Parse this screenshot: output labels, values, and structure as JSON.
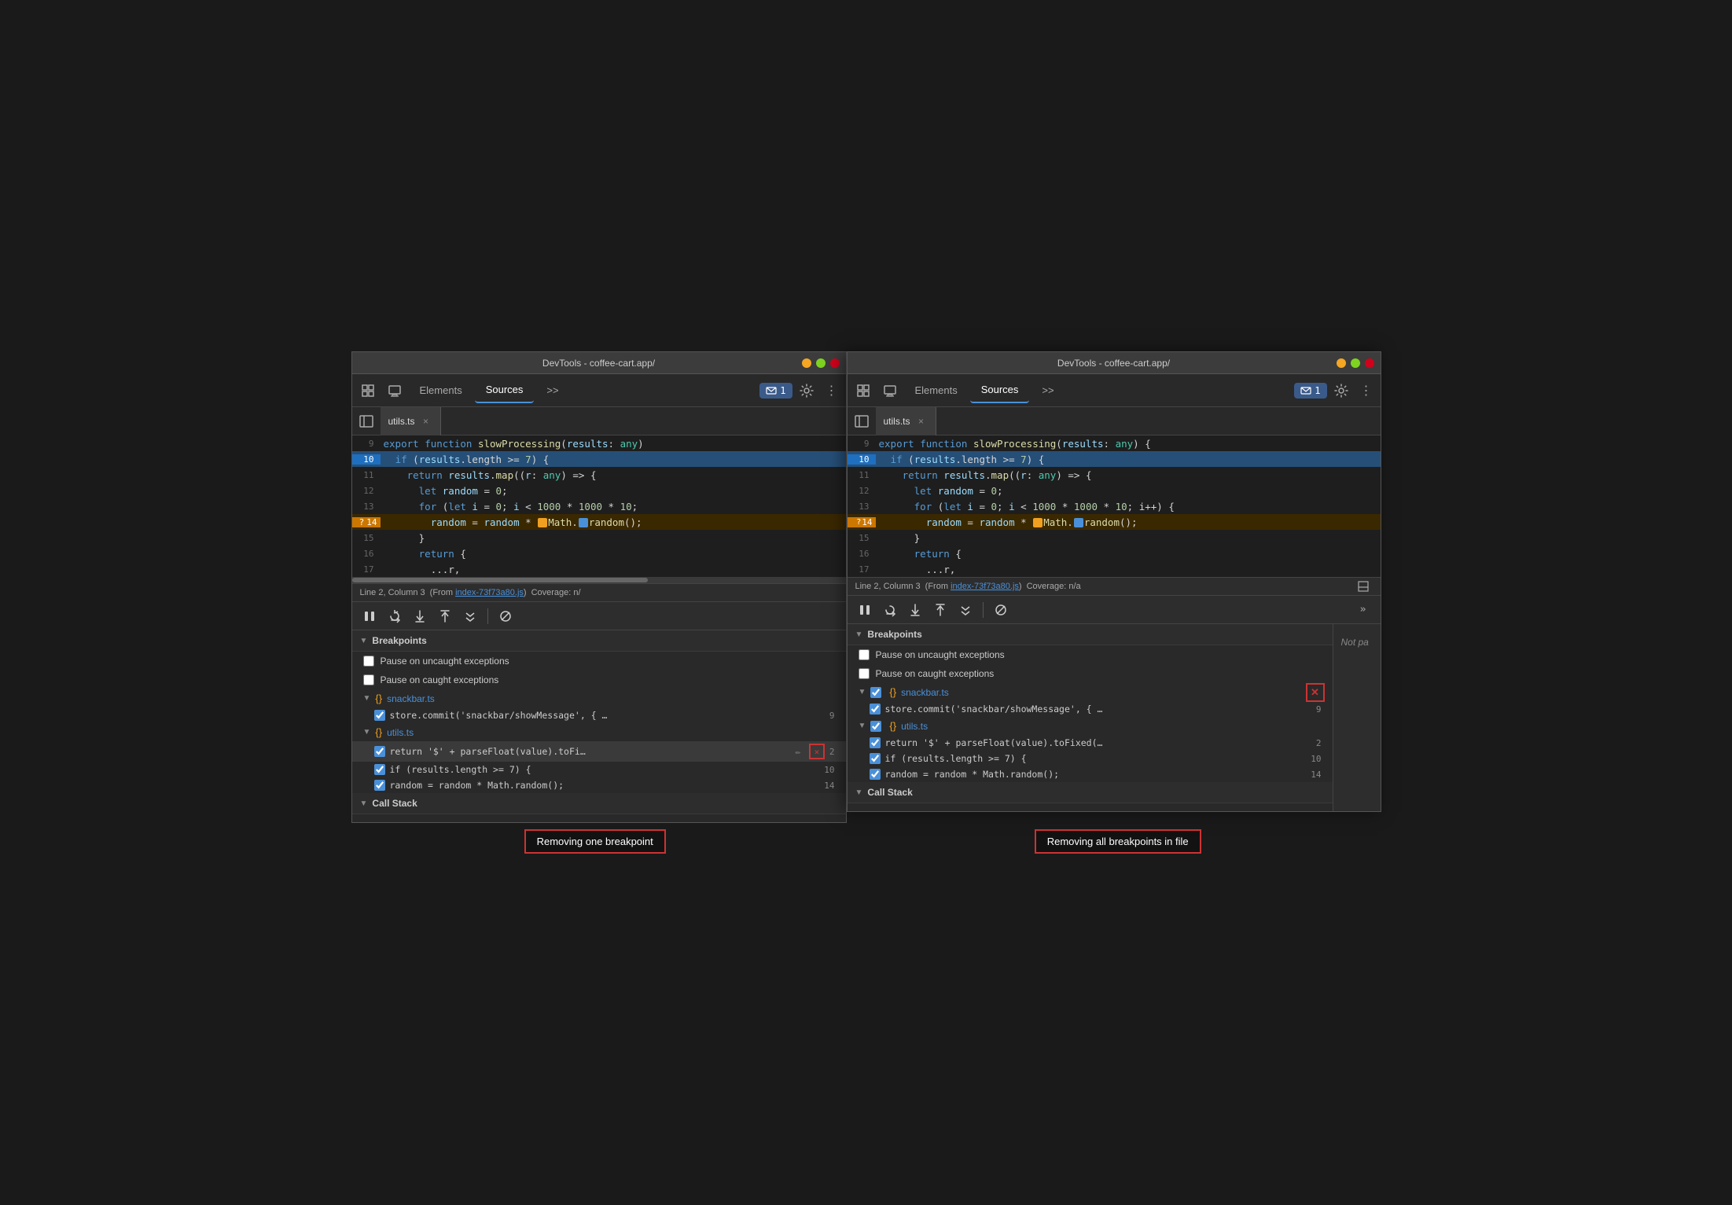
{
  "left_window": {
    "title": "DevTools - coffee-cart.app/",
    "tabs": [
      {
        "label": "Elements",
        "active": false
      },
      {
        "label": "Sources",
        "active": true
      },
      {
        "label": ">>",
        "active": false
      }
    ],
    "notification": "1",
    "file_tab": "utils.ts",
    "code_lines": [
      {
        "num": "9",
        "content": "export function slowProcessing(results: any)",
        "highlighted": false,
        "breakpoint": false
      },
      {
        "num": "10",
        "content": "  if (results.length >= 7) {",
        "highlighted": true,
        "breakpoint": false
      },
      {
        "num": "11",
        "content": "    return results.map((r: any) => {",
        "highlighted": false,
        "breakpoint": false
      },
      {
        "num": "12",
        "content": "      let random = 0;",
        "highlighted": false,
        "breakpoint": false
      },
      {
        "num": "13",
        "content": "      for (let i = 0; i < 1000 * 1000 * 10;",
        "highlighted": false,
        "breakpoint": false
      },
      {
        "num": "14",
        "content": "        random = random * 🟠Math.🔵random();",
        "highlighted": false,
        "breakpoint": true
      },
      {
        "num": "15",
        "content": "      }",
        "highlighted": false,
        "breakpoint": false
      },
      {
        "num": "16",
        "content": "      return {",
        "highlighted": false,
        "breakpoint": false
      },
      {
        "num": "17",
        "content": "        ...r,",
        "highlighted": false,
        "breakpoint": false
      }
    ],
    "status_bar": {
      "position": "Line 2, Column 3",
      "source": "(From index-73f73a80.js)",
      "source_link": "index-73f73a80.js",
      "coverage": "Coverage: n/"
    },
    "breakpoints": {
      "title": "Breakpoints",
      "pause_uncaught": "Pause on uncaught exceptions",
      "pause_caught": "Pause on caught exceptions",
      "files": [
        {
          "name": "snackbar.ts",
          "items": [
            {
              "text": "store.commit('snackbar/showMessage', { …",
              "line": "9",
              "checked": true
            }
          ]
        },
        {
          "name": "utils.ts",
          "items": [
            {
              "text": "return '$' + parseFloat(value).toFi…",
              "line": "2",
              "checked": true,
              "has_remove": true,
              "has_edit": true
            },
            {
              "text": "if (results.length >= 7) {",
              "line": "10",
              "checked": true
            },
            {
              "text": "random = random * Math.random();",
              "line": "14",
              "checked": true
            }
          ]
        }
      ]
    },
    "call_stack": {
      "title": "Call Stack"
    }
  },
  "right_window": {
    "title": "DevTools - coffee-cart.app/",
    "tabs": [
      {
        "label": "Elements",
        "active": false
      },
      {
        "label": "Sources",
        "active": true
      },
      {
        "label": ">>",
        "active": false
      }
    ],
    "notification": "1",
    "file_tab": "utils.ts",
    "code_lines": [
      {
        "num": "9",
        "content": "export function slowProcessing(results: any) {",
        "highlighted": false,
        "breakpoint": false
      },
      {
        "num": "10",
        "content": "  if (results.length >= 7) {",
        "highlighted": true,
        "breakpoint": false
      },
      {
        "num": "11",
        "content": "    return results.map((r: any) => {",
        "highlighted": false,
        "breakpoint": false
      },
      {
        "num": "12",
        "content": "      let random = 0;",
        "highlighted": false,
        "breakpoint": false
      },
      {
        "num": "13",
        "content": "      for (let i = 0; i < 1000 * 1000 * 10; i++) {",
        "highlighted": false,
        "breakpoint": false
      },
      {
        "num": "14",
        "content": "        random = random * 🟠Math.🔵random();",
        "highlighted": false,
        "breakpoint": true
      },
      {
        "num": "15",
        "content": "      }",
        "highlighted": false,
        "breakpoint": false
      },
      {
        "num": "16",
        "content": "      return {",
        "highlighted": false,
        "breakpoint": false
      },
      {
        "num": "17",
        "content": "        ...r,",
        "highlighted": false,
        "breakpoint": false
      }
    ],
    "status_bar": {
      "position": "Line 2, Column 3",
      "source": "(From index-73f73a80.js)",
      "source_link": "index-73f73a80.js",
      "coverage": "Coverage: n/a"
    },
    "breakpoints": {
      "title": "Breakpoints",
      "pause_uncaught": "Pause on uncaught exceptions",
      "pause_caught": "Pause on caught exceptions",
      "files": [
        {
          "name": "snackbar.ts",
          "items": [
            {
              "text": "store.commit('snackbar/showMessage', { …",
              "line": "9",
              "checked": true
            }
          ],
          "has_remove_all": true
        },
        {
          "name": "utils.ts",
          "items": [
            {
              "text": "return '$' + parseFloat(value).toFixed(…",
              "line": "2",
              "checked": true
            },
            {
              "text": "if (results.length >= 7) {",
              "line": "10",
              "checked": true
            },
            {
              "text": "random = random * Math.random();",
              "line": "14",
              "checked": true
            }
          ]
        }
      ]
    },
    "call_stack": {
      "title": "Call Stack"
    },
    "not_pa_text": "Not pa"
  },
  "annotations": {
    "left": "Removing one breakpoint",
    "right": "Removing all breakpoints in file"
  }
}
